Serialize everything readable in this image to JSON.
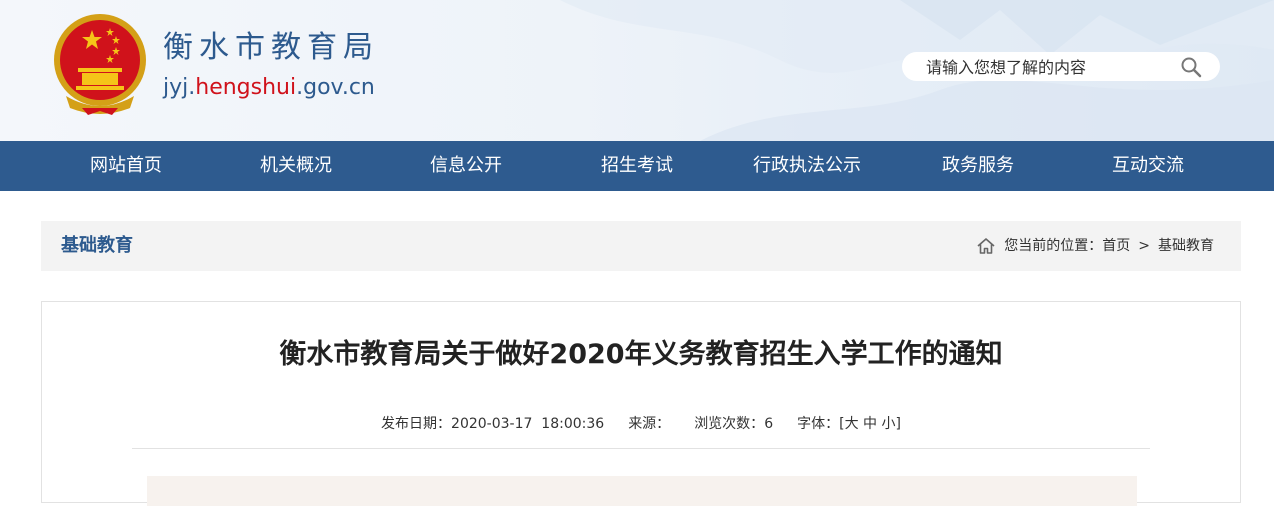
{
  "header": {
    "site_name": "衡水市教育局",
    "domain_prefix": "jyj.",
    "domain_highlight": "hengshui",
    "domain_suffix": ".gov.cn",
    "emblem_icon": "national-emblem-icon",
    "colors": {
      "brand_blue": "#2e5b8f",
      "accent_red": "#d0121b"
    }
  },
  "search": {
    "placeholder": "请输入您想了解的内容",
    "icon": "search-icon"
  },
  "nav": {
    "items": [
      {
        "label": "网站首页"
      },
      {
        "label": "机关概况"
      },
      {
        "label": "信息公开"
      },
      {
        "label": "招生考试"
      },
      {
        "label": "行政执法公示"
      },
      {
        "label": "政务服务"
      },
      {
        "label": "互动交流"
      }
    ]
  },
  "location": {
    "section_title": "基础教育",
    "prefix": "您当前的位置：",
    "home_label": "首页",
    "separator": ">",
    "current": "基础教育",
    "icon": "home-icon"
  },
  "article": {
    "title": "衡水市教育局关于做好2020年义务教育招生入学工作的通知",
    "publish_label": "发布日期：",
    "publish_date": "2020-03-17  18:00:36",
    "source_label": "来源：",
    "views_label": "浏览次数：",
    "views": "6",
    "font_label": "字体：",
    "font_open": "[",
    "font_large": "大",
    "font_medium": "中",
    "font_small": "小",
    "font_close": "]"
  }
}
